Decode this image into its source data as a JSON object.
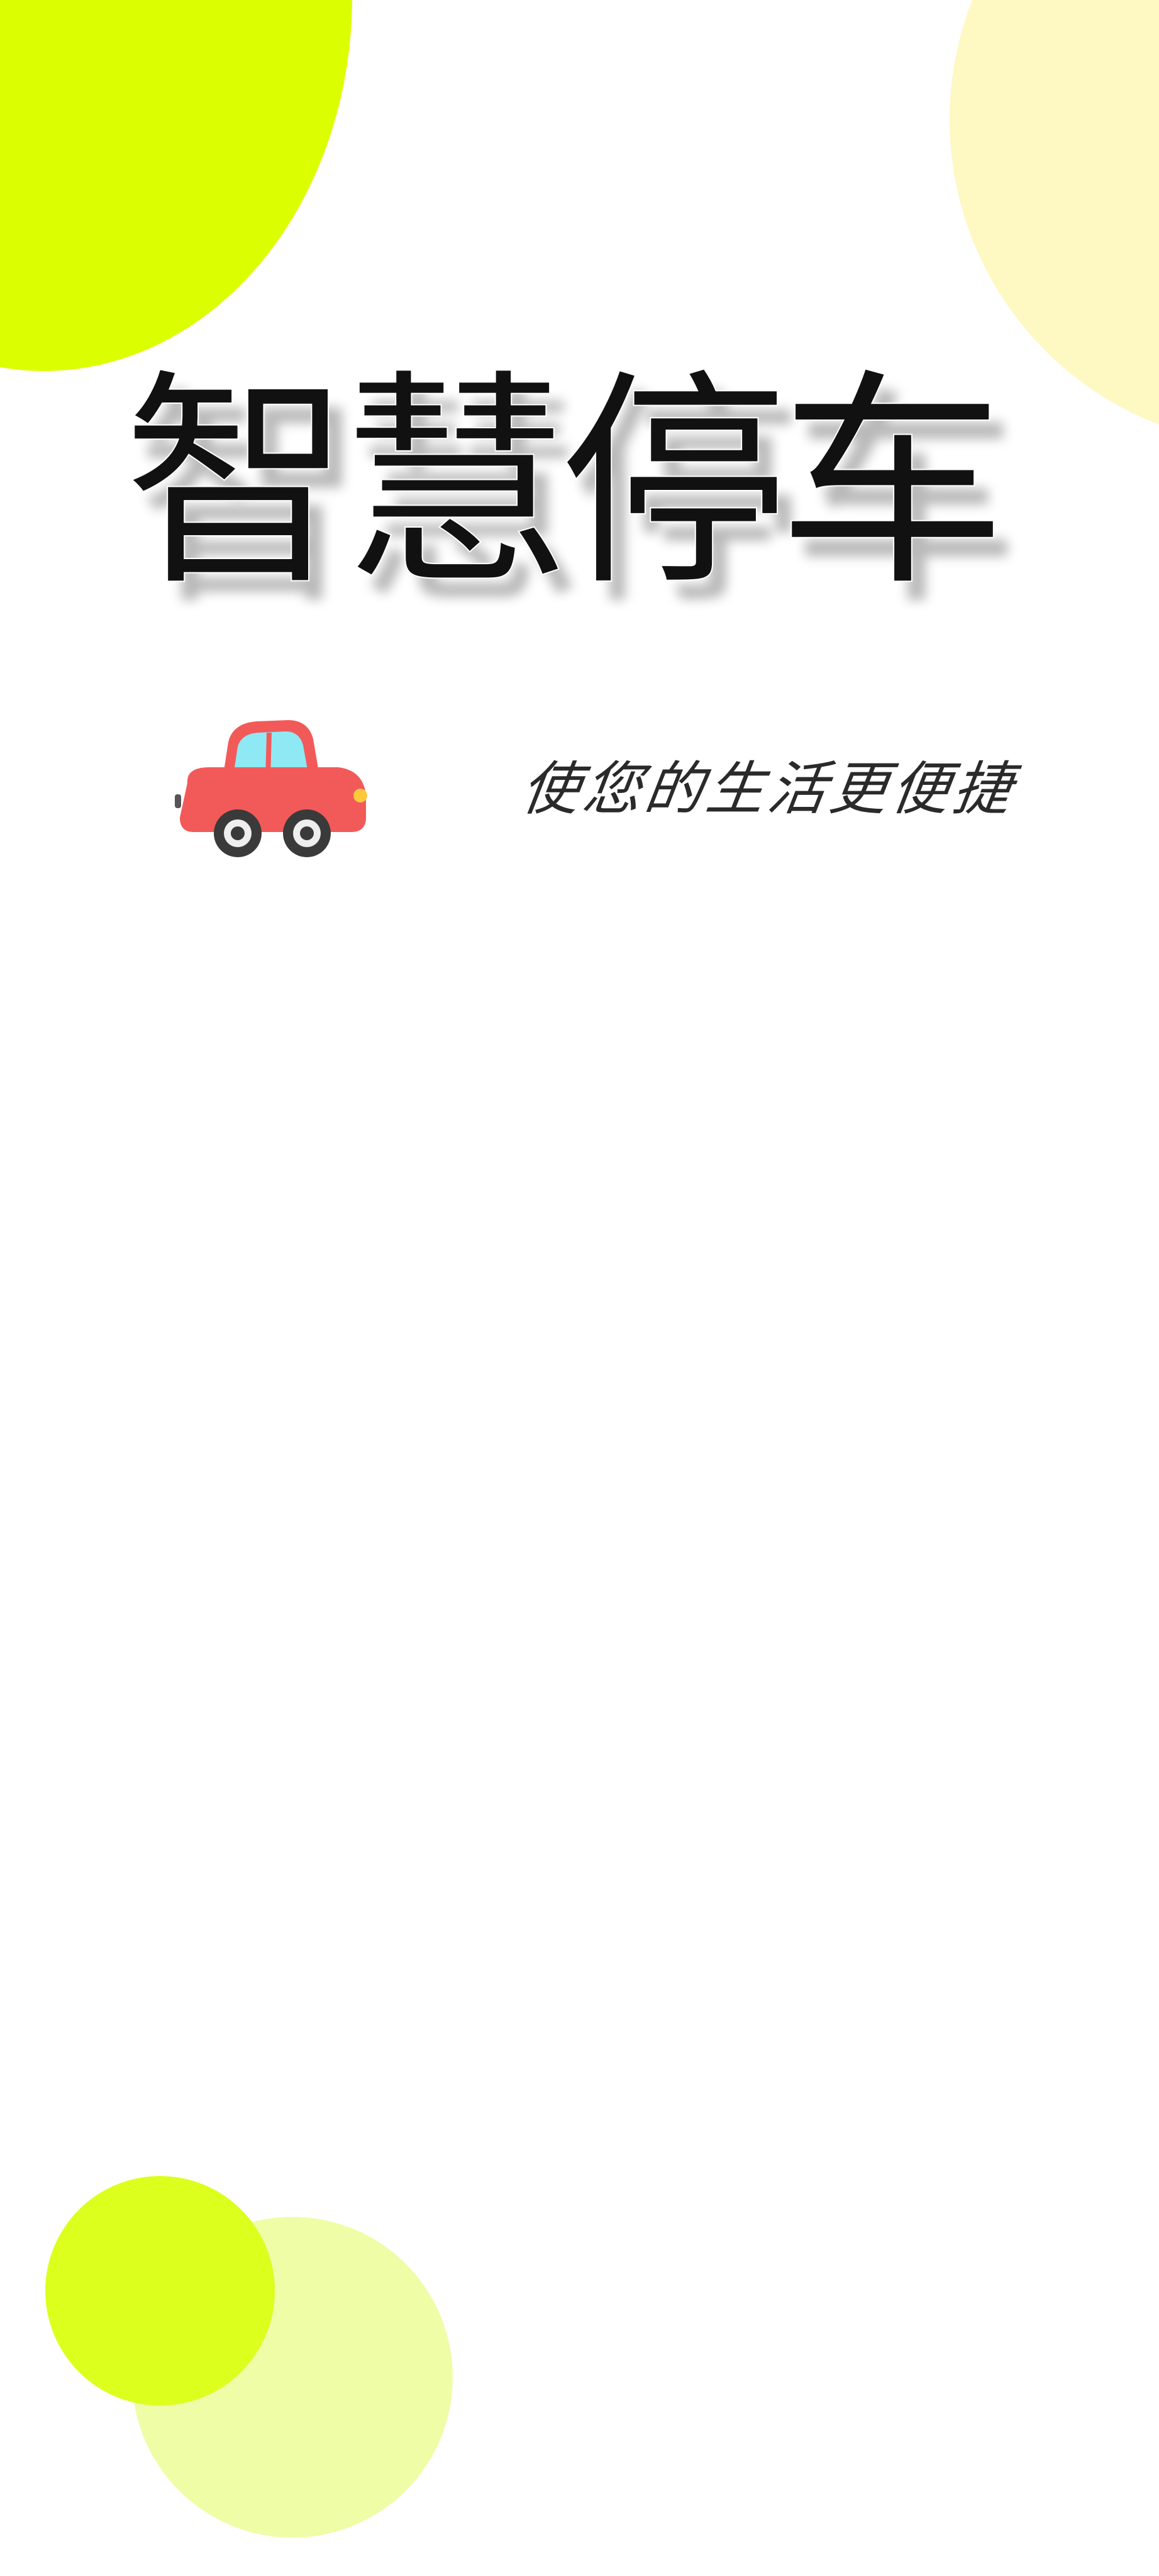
{
  "splash": {
    "title": "智慧停车",
    "slogan": "使您的生活更便捷",
    "illustration": "red-car-icon"
  },
  "colors": {
    "background": "#ffffff",
    "circle_yellow_green": "#dcff00",
    "circle_cream": "#fef8c3",
    "circle_light_lime": "#effda6",
    "title_text": "#111111",
    "car_body": "#f25a5a",
    "car_window": "#8fe9f5"
  }
}
